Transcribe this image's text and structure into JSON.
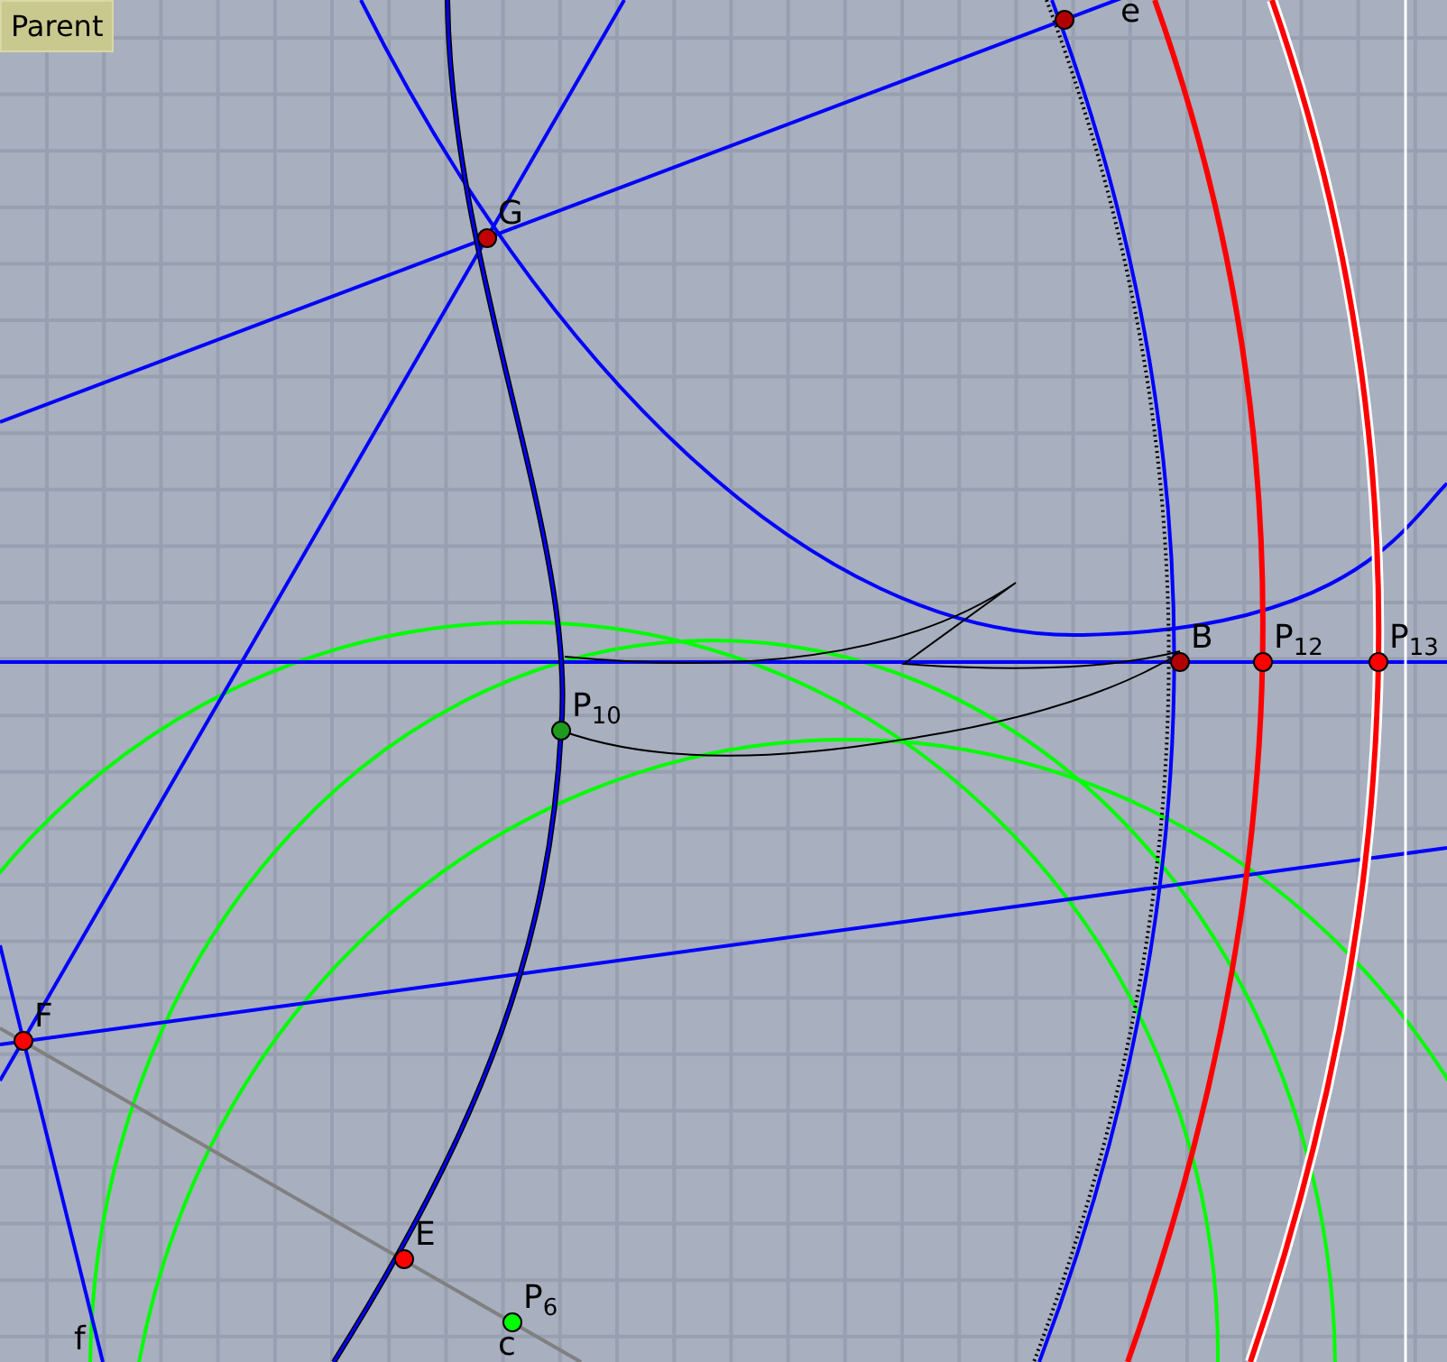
{
  "toolbar": {
    "parent_button": "Parent"
  },
  "points": [
    {
      "label": "G",
      "color": "#c00000"
    },
    {
      "color": "#b00000"
    },
    {
      "label": "B",
      "color": "#b00000"
    },
    {
      "label": "P$_{12}$",
      "color": "#ff0000"
    },
    {
      "label": "P$_{13}$",
      "color": "#ff0000"
    },
    {
      "label": "P$_{10}$",
      "color": "#1f9a1f"
    },
    {
      "label": "F",
      "color": "#ff0000"
    },
    {
      "label": "E",
      "color": "#ff0000"
    },
    {
      "label": "P$_{6}$",
      "color": "#00ff00"
    }
  ],
  "curve_labels": [
    {
      "label": "e"
    },
    {
      "label": "c"
    },
    {
      "label": "f"
    }
  ]
}
